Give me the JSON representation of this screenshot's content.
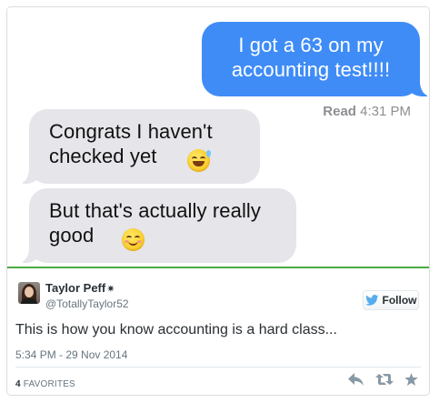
{
  "conversation": {
    "sent_message": "I got a 63 on my accounting test!!!!",
    "read_label": "Read",
    "read_time": "4:31 PM",
    "received": [
      {
        "text": "Congrats I haven't checked yet",
        "emoji": "grinning-sweat-emoji"
      },
      {
        "text": "But that's actually really good",
        "emoji": "smiling-blush-emoji"
      }
    ]
  },
  "tweet": {
    "display_name": "Taylor Peff",
    "name_symbol": "✷",
    "screen_name": "@TotallyTaylor52",
    "follow_label": "Follow",
    "text": "This is how you know accounting is a hard class...",
    "timestamp": "5:34 PM - 29 Nov 2014",
    "favorites_count": "4",
    "favorites_label": "FAVORITES"
  },
  "colors": {
    "sent_bubble": "#3f8cf7",
    "received_bubble": "#e5e5ea",
    "divider": "#4aaa46",
    "twitter_blue": "#55acee"
  }
}
